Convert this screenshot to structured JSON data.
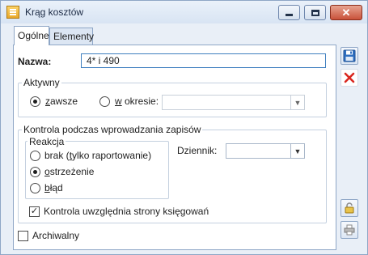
{
  "window": {
    "title": "Krąg kosztów",
    "minimize_icon": "minimize-icon",
    "maximize_icon": "maximize-icon",
    "close_icon": "close-icon"
  },
  "tabs": [
    {
      "label": "Ogólne",
      "active": true
    },
    {
      "label": "Elementy",
      "active": false
    }
  ],
  "form": {
    "name_label": "Nazwa:",
    "name_value": "4* i 490",
    "active_group": {
      "legend": "Aktywny",
      "option_always_prefix": "z",
      "option_always_rest": "awsze",
      "option_period_prefix": "w",
      "option_period_rest": " okresie:",
      "selected": "zawsze",
      "period_value": ""
    },
    "control_group": {
      "legend": "Kontrola podczas wprowadzania zapisów",
      "reaction_group": {
        "legend": "Reakcja",
        "options": [
          {
            "pre": "brak (",
            "ul": "t",
            "post": "ylko raportowanie)",
            "checked": false
          },
          {
            "pre": "",
            "ul": "o",
            "post": "strzeżenie",
            "checked": true
          },
          {
            "pre": "",
            "ul": "b",
            "post": "łąd",
            "checked": false
          }
        ]
      },
      "journal_label": "Dziennik:",
      "journal_value": "",
      "sides_checkbox_label": "Kontrola uwzględnia strony księgowań",
      "sides_checked": true
    },
    "archived_label": "Archiwalny",
    "archived_checked": false,
    "check_mark": "✓"
  },
  "side_buttons": {
    "save_icon": "floppy-disk-icon",
    "delete_icon": "delete-x-icon",
    "lock_icon": "padlock-icon",
    "print_icon": "print-icon"
  },
  "colors": {
    "accent_blue": "#3f7fbf",
    "delete_red": "#d9271f",
    "window_bg": "#e9eff7",
    "border": "#8ea6c6"
  }
}
